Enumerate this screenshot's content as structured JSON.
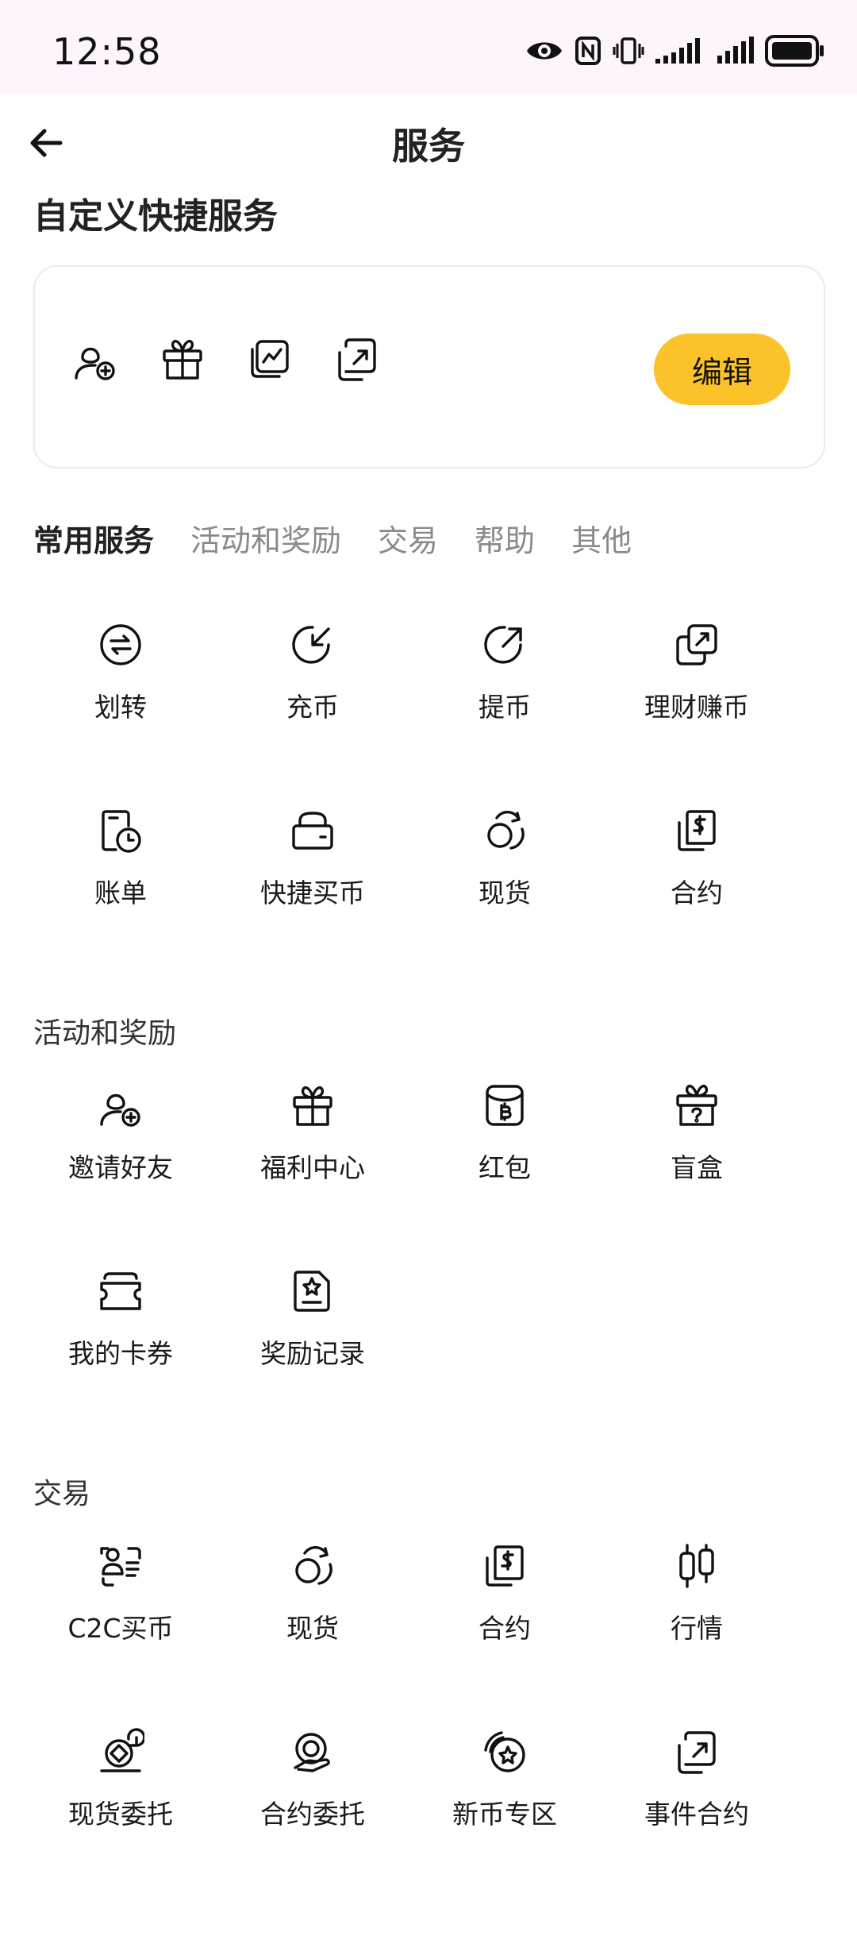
{
  "status_bar": {
    "time": "12:58"
  },
  "nav": {
    "title": "服务"
  },
  "custom_section": {
    "title": "自定义快捷服务",
    "edit_label": "编辑",
    "icons": [
      "invite-friend-icon",
      "gift-icon",
      "chart-cards-icon",
      "event-contract-icon"
    ]
  },
  "tabs": [
    {
      "label": "常用服务",
      "active": true
    },
    {
      "label": "活动和奖励",
      "active": false
    },
    {
      "label": "交易",
      "active": false
    },
    {
      "label": "帮助",
      "active": false
    },
    {
      "label": "其他",
      "active": false
    }
  ],
  "common": {
    "items": [
      {
        "label": "划转",
        "icon": "transfer-icon"
      },
      {
        "label": "充币",
        "icon": "deposit-icon"
      },
      {
        "label": "提币",
        "icon": "withdraw-icon"
      },
      {
        "label": "理财赚币",
        "icon": "earn-icon"
      },
      {
        "label": "账单",
        "icon": "bill-icon"
      },
      {
        "label": "快捷买币",
        "icon": "quick-buy-icon"
      },
      {
        "label": "现货",
        "icon": "spot-icon"
      },
      {
        "label": "合约",
        "icon": "contract-icon"
      }
    ]
  },
  "rewards": {
    "title": "活动和奖励",
    "items": [
      {
        "label": "邀请好友",
        "icon": "invite-friend-icon"
      },
      {
        "label": "福利中心",
        "icon": "gift-icon"
      },
      {
        "label": "红包",
        "icon": "red-packet-icon"
      },
      {
        "label": "盲盒",
        "icon": "mystery-box-icon"
      },
      {
        "label": "我的卡券",
        "icon": "coupon-icon"
      },
      {
        "label": "奖励记录",
        "icon": "reward-record-icon"
      }
    ]
  },
  "trade": {
    "title": "交易",
    "items": [
      {
        "label": "C2C买币",
        "icon": "c2c-icon"
      },
      {
        "label": "现货",
        "icon": "spot-icon"
      },
      {
        "label": "合约",
        "icon": "contract-icon"
      },
      {
        "label": "行情",
        "icon": "candlestick-icon"
      },
      {
        "label": "现货委托",
        "icon": "spot-order-icon"
      },
      {
        "label": "合约委托",
        "icon": "contract-order-icon"
      },
      {
        "label": "新币专区",
        "icon": "new-coin-icon"
      },
      {
        "label": "事件合约",
        "icon": "event-contract-icon"
      }
    ]
  }
}
